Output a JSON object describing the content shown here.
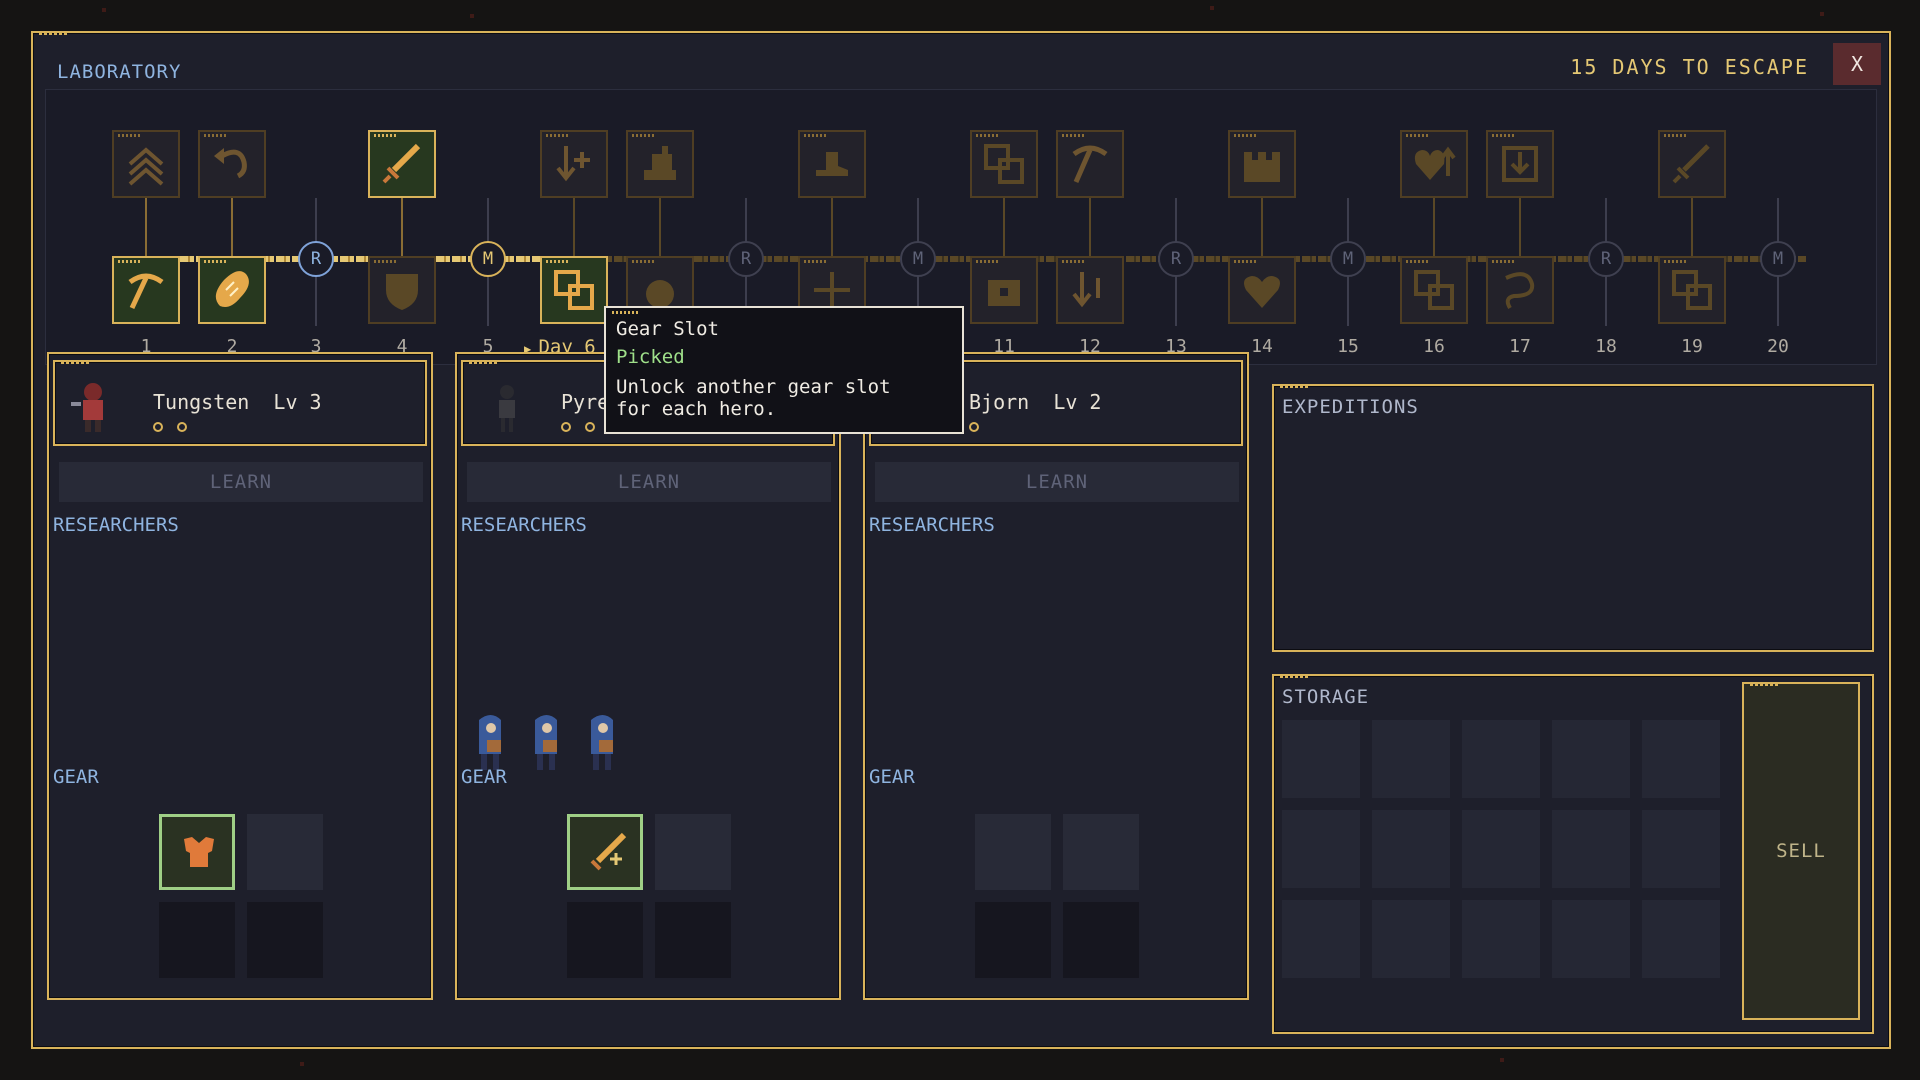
{
  "window": {
    "title": "LABORATORY",
    "days_label": "15 DAYS TO ESCAPE",
    "close_label": "X"
  },
  "timeline": {
    "current_day_label": "Day 6",
    "days": [
      "1",
      "2",
      "3",
      "4",
      "5",
      "Day 6",
      "7",
      "8",
      "9",
      "10",
      "11",
      "12",
      "13",
      "14",
      "15",
      "16",
      "17",
      "18",
      "19",
      "20"
    ],
    "markers": {
      "3": "R",
      "5": "M",
      "7": "R",
      "9": "M",
      "13": "R",
      "15": "M",
      "18": "R",
      "20": "M"
    }
  },
  "heroes": [
    {
      "name": "Tungsten",
      "level": "Lv 3",
      "dots": 2,
      "learn_label": "LEARN",
      "researchers_label": "RESEARCHERS",
      "gear_label": "GEAR",
      "researcher_count": 0
    },
    {
      "name": "Pyre",
      "level": "",
      "dots": 3,
      "learn_label": "LEARN",
      "researchers_label": "RESEARCHERS",
      "gear_label": "GEAR",
      "researcher_count": 3
    },
    {
      "name": "Bjorn",
      "level": "Lv 2",
      "dots": 1,
      "learn_label": "LEARN",
      "researchers_label": "RESEARCHERS",
      "gear_label": "GEAR",
      "researcher_count": 0
    }
  ],
  "expeditions": {
    "title": "EXPEDITIONS"
  },
  "storage": {
    "title": "STORAGE",
    "sell_label": "SELL"
  },
  "tooltip": {
    "title": "Gear Slot",
    "status": "Picked",
    "description": "Unlock another gear slot\nfor each hero."
  },
  "colors": {
    "gold": "#d9b35a",
    "blue_text": "#8fb4e0",
    "picked_green": "#9fe08a",
    "panel_bg": "#1e1f2b"
  },
  "icons": [
    "chevrons-up-icon",
    "undo-arrow-icon",
    "sword-icon",
    "arrow-down-plus-icon",
    "anvil-icon",
    "boot-icon",
    "gear-slot-icon",
    "pickaxe-icon",
    "castle-icon",
    "heart-up-icon",
    "shield-down-icon",
    "loaf-icon",
    "shield-icon",
    "bomb-icon",
    "crossbow-icon",
    "chest-icon",
    "arrow-down-up-icon",
    "heart-icon",
    "rope-icon"
  ]
}
